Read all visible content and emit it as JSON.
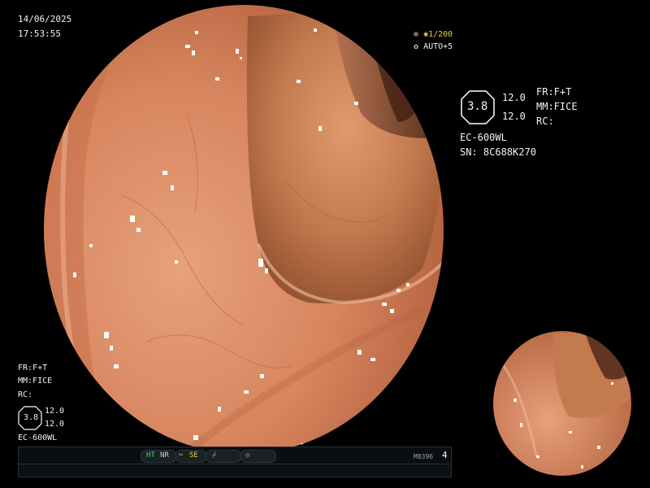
{
  "timestamp": {
    "date": "14/06/2025",
    "time": "17:53:55"
  },
  "exposure": {
    "shutter": "1/200",
    "auto": "AUTO+5"
  },
  "settings_right": {
    "fr": "FR:F+T",
    "mm": "MM:FICE",
    "rc": "RC:"
  },
  "zoom_right": {
    "value": "3.8",
    "top": "12.0",
    "bottom": "12.0"
  },
  "scope_info": {
    "model": "EC-600WL",
    "serial": "SN: 8C688K270"
  },
  "settings_left": {
    "fr": "FR:F+T",
    "mm": "MM:FICE",
    "rc": "RC:"
  },
  "zoom_left": {
    "value": "3.8",
    "top": "12.0",
    "bottom": "12.0",
    "model": "EC-600WL"
  },
  "status_bar": {
    "ht": "HT",
    "nr": "NR",
    "se": "SE",
    "code": "M8396",
    "page": "4"
  },
  "colors": {
    "accent_green": "#4cd060",
    "accent_yellow": "#e8d24a",
    "tissue": "#d98a66"
  },
  "icons": [
    "exposure-icon",
    "auto-icon",
    "scissors-icon",
    "slash-icon",
    "circle-icon"
  ]
}
